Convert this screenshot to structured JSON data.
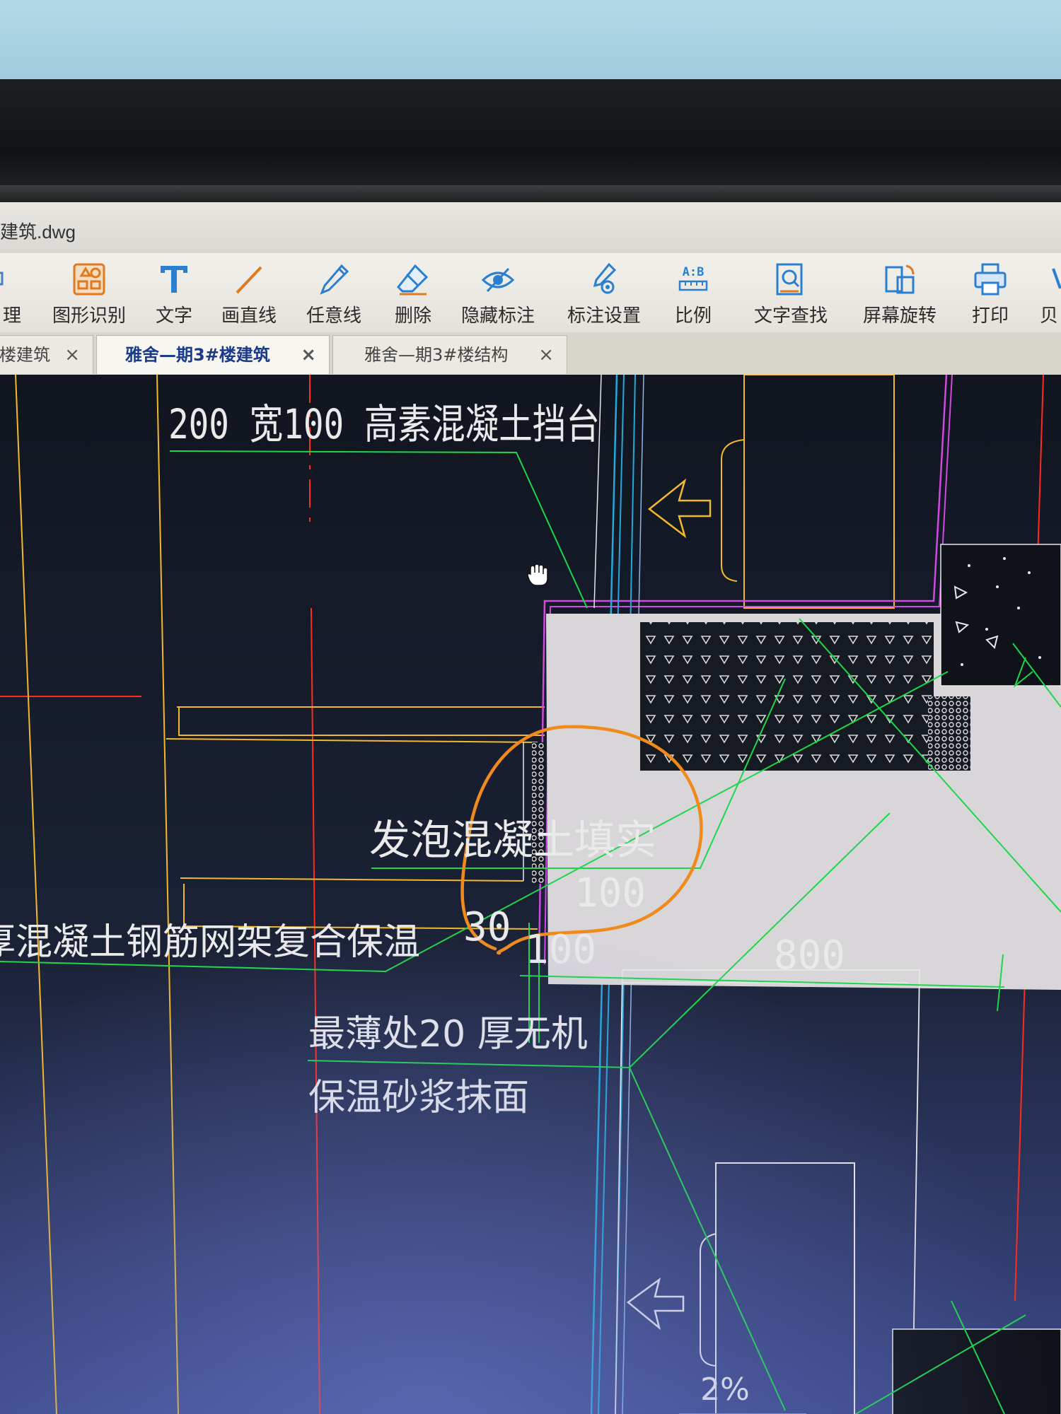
{
  "window": {
    "title": "建筑.dwg"
  },
  "toolbar": {
    "items": [
      {
        "label": "理",
        "icon": "measure-icon"
      },
      {
        "label": "图形识别",
        "icon": "shape-recognition-icon"
      },
      {
        "label": "文字",
        "icon": "text-tool-icon"
      },
      {
        "label": "画直线",
        "icon": "draw-line-icon"
      },
      {
        "label": "任意线",
        "icon": "freehand-pen-icon"
      },
      {
        "label": "删除",
        "icon": "eraser-icon"
      },
      {
        "label": "隐藏标注",
        "icon": "hide-eye-icon"
      },
      {
        "label": "标注设置",
        "icon": "annotation-settings-icon"
      },
      {
        "label": "比例",
        "icon": "scale-ruler-icon"
      },
      {
        "label": "文字查找",
        "icon": "text-search-icon"
      },
      {
        "label": "屏幕旋转",
        "icon": "screen-rotate-icon"
      },
      {
        "label": "打印",
        "icon": "printer-icon"
      },
      {
        "label": "贝",
        "icon": "more-tool-icon"
      }
    ]
  },
  "tabs": [
    {
      "label": "楼建筑",
      "close": "×",
      "active": false
    },
    {
      "label": "雅舍—期3#楼建筑",
      "close": "×",
      "active": true
    },
    {
      "label": "雅舍—期3#楼结构",
      "close": "×",
      "active": false
    }
  ],
  "drawing": {
    "annotations": {
      "top_label": "200 宽100 高素混凝土挡台",
      "foam_label": "发泡混凝土填实",
      "left_label": "厚混凝土钢筋网架复合保温",
      "mortar_line1": "最薄处20 厚无机",
      "mortar_line2": "保温砂浆抹面",
      "slope": "2%"
    },
    "dimensions": {
      "d100_upper": "100",
      "d30": "30",
      "d100_lower": "100",
      "d800": "800"
    },
    "colors": {
      "background": "#131a29",
      "green": "#1ed64a",
      "yellow": "#f2b928",
      "red": "#ff2a20",
      "cyan": "#23a9dc",
      "magenta": "#d04ae0",
      "white": "#e8e8e8",
      "orange_markup": "#f08a1c"
    }
  }
}
